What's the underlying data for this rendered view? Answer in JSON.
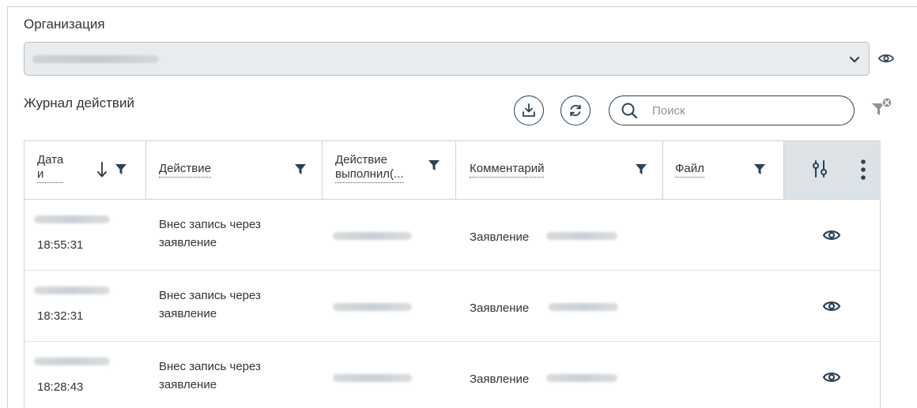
{
  "organization": {
    "label": "Организация",
    "icons": {
      "dropdown": "chevron-down-icon",
      "view": "eye-icon"
    }
  },
  "journal": {
    "title": "Журнал действий",
    "toolbar": {
      "download_icon": "download-icon",
      "refresh_icon": "refresh-icon",
      "clear_filter_icon": "filter-clear-icon"
    },
    "search": {
      "placeholder": "Поиск",
      "value": ""
    }
  },
  "table": {
    "columns": [
      {
        "line1": "Дата",
        "line2": "и",
        "sort": "descending"
      },
      {
        "line1": "Действие"
      },
      {
        "line1": "Действие",
        "line2": "выполнил(..."
      },
      {
        "line1": "Комментарий"
      },
      {
        "line1": "Файл"
      }
    ],
    "rows": [
      {
        "time": "18:55:31",
        "action_line1": "Внес запись через",
        "action_line2": "заявление",
        "comment": "Заявление"
      },
      {
        "time": "18:32:31",
        "action_line1": "Внес запись через",
        "action_line2": "заявление",
        "comment": "Заявление"
      },
      {
        "time": "18:28:43",
        "action_line1": "Внес запись через",
        "action_line2": "заявление",
        "comment": "Заявление"
      }
    ]
  },
  "colors": {
    "icon": "#2a4257",
    "border": "#cfd4d9",
    "header_settings_bg": "#dde2e7",
    "select_bg": "#e8ecef"
  }
}
